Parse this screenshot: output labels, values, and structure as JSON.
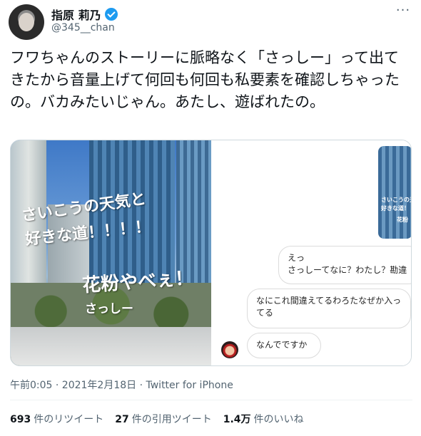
{
  "header": {
    "display_name": "指原 莉乃",
    "handle": "@345__chan",
    "more_icon": "more-icon",
    "verified_icon": "verified-badge-icon"
  },
  "tweet": {
    "text": "フワちゃんのストーリーに脈略なく「さっしー」って出てきたから音量上げて何回も何回も私要素を確認しちゃったの。バカみたいじゃん。あたし、遊ばれたの。"
  },
  "media": {
    "photo_overlay": {
      "line1": "さいこうの天気と",
      "line2": "好きな道！！！！",
      "line3": "花粉やべぇ！",
      "line4": "さっしー"
    },
    "chat": {
      "thumb_line1": "さいこうの天気と",
      "thumb_line2": "好きな道！",
      "thumb_line3": "花粉",
      "bubble1_line1": "えっ",
      "bubble1_line2": "さっしーてなに？わたし？勘違",
      "bubble2": "なにこれ間違えてるわろたなぜか入ってる",
      "bubble3": "なんでですか"
    }
  },
  "meta": {
    "timestamp": "午前0:05 · 2021年2月18日 · Twitter for iPhone"
  },
  "stats": {
    "retweets_count": "693",
    "retweets_label": "件のリツイート",
    "quotes_count": "27",
    "quotes_label": "件の引用ツイート",
    "likes_count": "1.4万",
    "likes_label": "件のいいね"
  }
}
